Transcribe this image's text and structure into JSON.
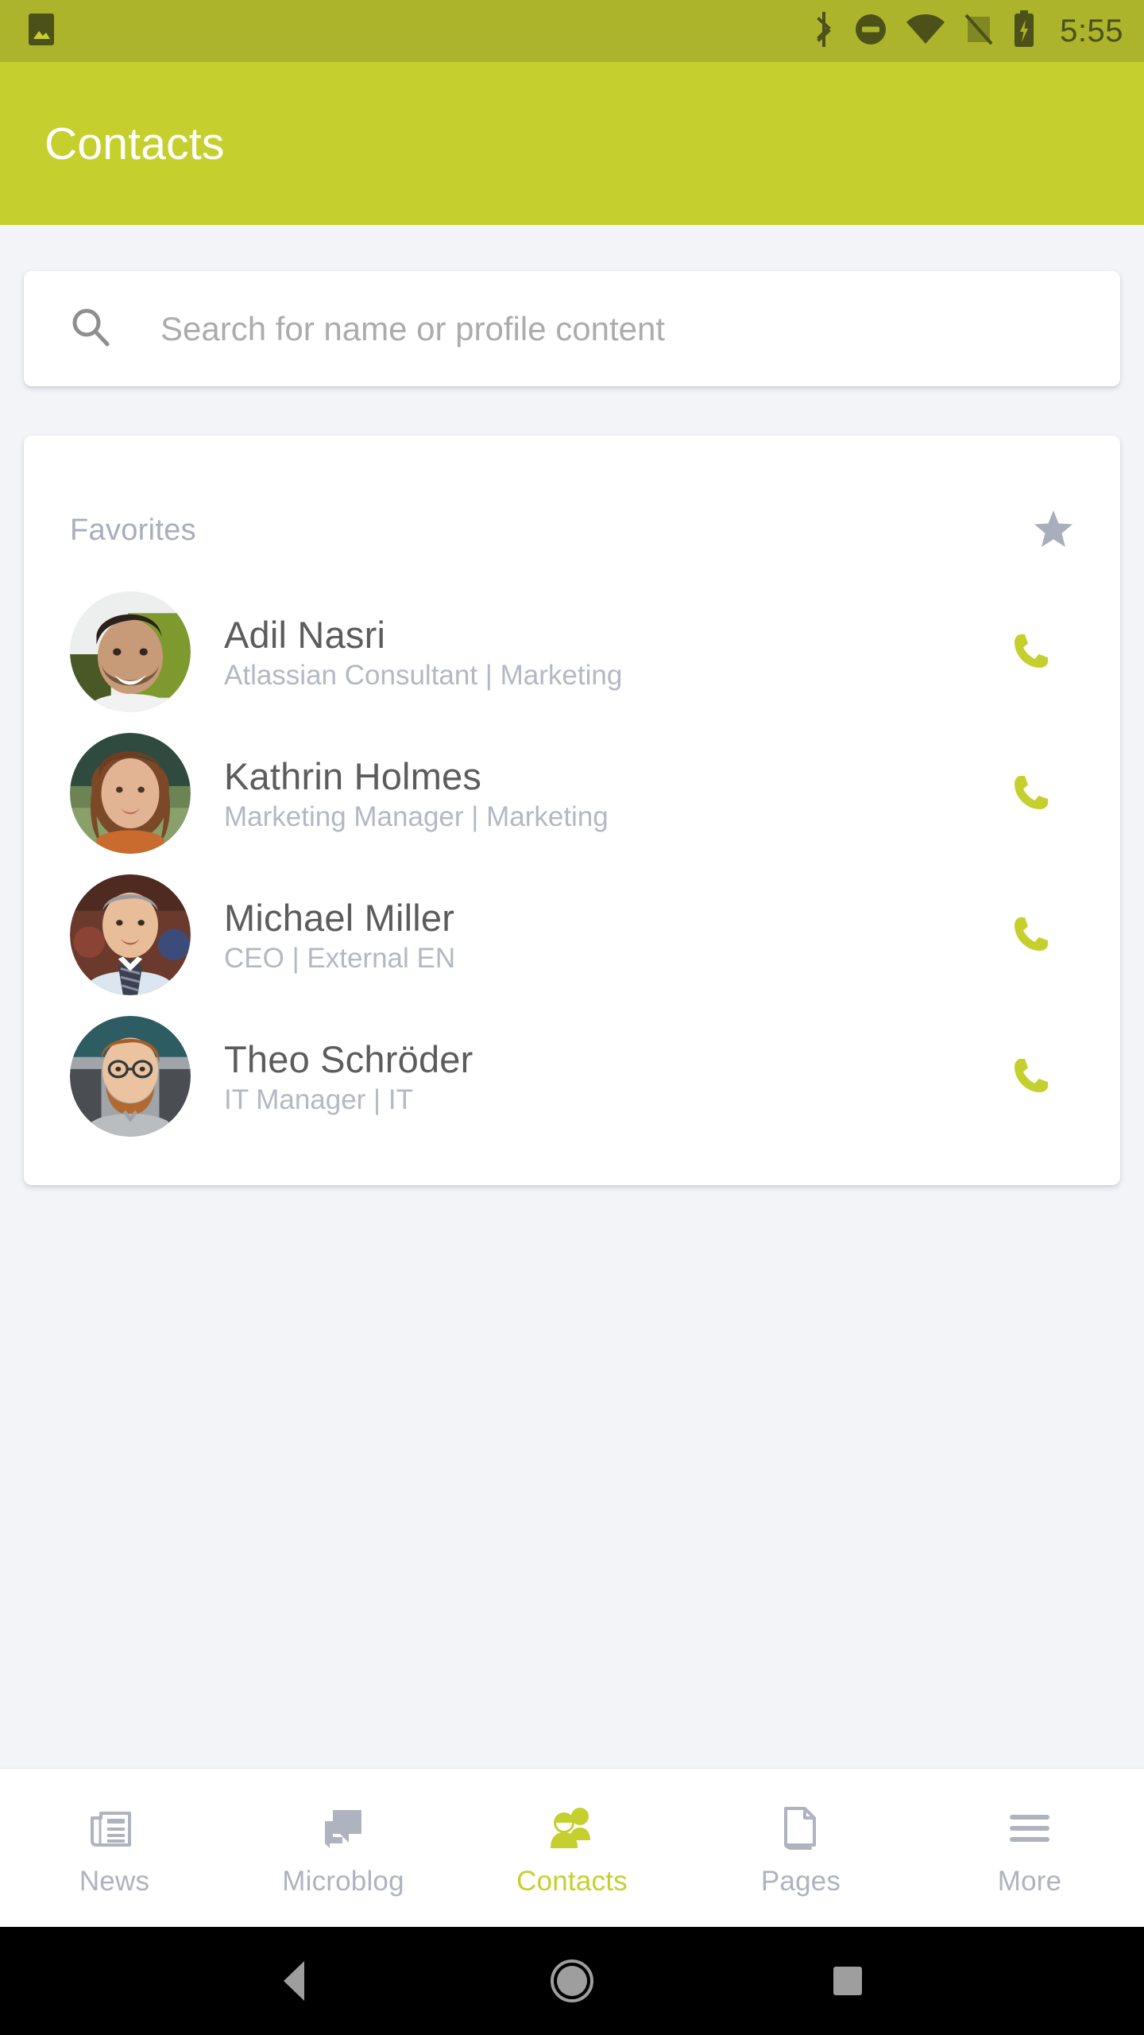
{
  "status_bar": {
    "time": "5:55",
    "icons": {
      "notification": "image-notification-icon",
      "bluetooth": "bluetooth-icon",
      "dnd": "do-not-disturb-icon",
      "wifi": "wifi-icon",
      "signal": "no-signal-icon",
      "battery": "battery-charging-icon"
    },
    "colors": {
      "background": "#ACB42B",
      "foreground": "#4C511A"
    }
  },
  "app_bar": {
    "title": "Contacts",
    "colors": {
      "background": "#C5D02E",
      "text": "#FFFFFF"
    }
  },
  "search": {
    "placeholder": "Search for name or profile content",
    "value": "",
    "icon": "search-icon"
  },
  "favorites": {
    "title": "Favorites",
    "star_icon": "star-filled-icon",
    "contacts": [
      {
        "name": "Adil Nasri",
        "subtitle": "Atlassian Consultant | Marketing",
        "action_icon": "phone-icon",
        "avatar_alt": "Adil Nasri profile photo"
      },
      {
        "name": "Kathrin Holmes",
        "subtitle": "Marketing Manager | Marketing",
        "action_icon": "phone-icon",
        "avatar_alt": "Kathrin Holmes profile photo"
      },
      {
        "name": "Michael Miller",
        "subtitle": "CEO | External EN",
        "action_icon": "phone-icon",
        "avatar_alt": "Michael Miller profile photo"
      },
      {
        "name": "Theo Schröder",
        "subtitle": "IT Manager | IT",
        "action_icon": "phone-icon",
        "avatar_alt": "Theo Schröder profile photo"
      }
    ]
  },
  "bottom_nav": {
    "active": "Contacts",
    "items": [
      {
        "label": "News",
        "icon": "newspaper-icon"
      },
      {
        "label": "Microblog",
        "icon": "chat-bubble-icon"
      },
      {
        "label": "Contacts",
        "icon": "people-icon"
      },
      {
        "label": "Pages",
        "icon": "document-icon"
      },
      {
        "label": "More",
        "icon": "hamburger-menu-icon"
      }
    ]
  },
  "system_nav": {
    "back": "back-triangle-icon",
    "home": "home-circle-icon",
    "recents": "recents-square-icon"
  },
  "theme": {
    "accent": "#C5D02E",
    "accent_dark": "#ACB42B",
    "page_background": "#F3F4F8",
    "card_background": "#FFFFFF",
    "primary_text": "#5C5C5C",
    "secondary_text": "#B4B8C4"
  }
}
